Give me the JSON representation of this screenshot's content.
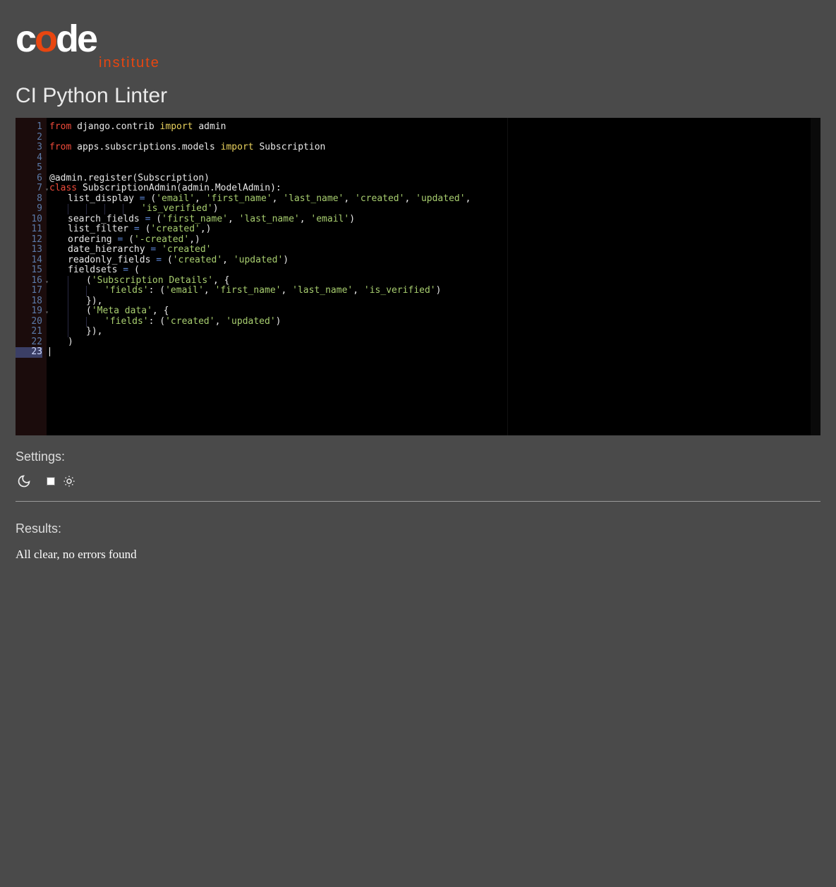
{
  "logo": {
    "top": "code",
    "bottom": "institute"
  },
  "title": "CI Python Linter",
  "code": {
    "lines": [
      {
        "n": 1,
        "fold": false,
        "segments": [
          {
            "t": "from ",
            "c": "kw-red"
          },
          {
            "t": "django.contrib ",
            "c": "fn"
          },
          {
            "t": "import ",
            "c": "kw-yellow"
          },
          {
            "t": "admin",
            "c": "fn"
          }
        ]
      },
      {
        "n": 2,
        "fold": false,
        "segments": []
      },
      {
        "n": 3,
        "fold": false,
        "segments": [
          {
            "t": "from ",
            "c": "kw-red"
          },
          {
            "t": "apps.subscriptions.models ",
            "c": "fn"
          },
          {
            "t": "import ",
            "c": "kw-yellow"
          },
          {
            "t": "Subscription",
            "c": "fn"
          }
        ]
      },
      {
        "n": 4,
        "fold": false,
        "segments": []
      },
      {
        "n": 5,
        "fold": false,
        "segments": []
      },
      {
        "n": 6,
        "fold": false,
        "segments": [
          {
            "t": "@admin.register(Subscription)",
            "c": "fn"
          }
        ]
      },
      {
        "n": 7,
        "fold": true,
        "segments": [
          {
            "t": "class ",
            "c": "kw-red"
          },
          {
            "t": "SubscriptionAdmin",
            "c": "fn"
          },
          {
            "t": "(admin.ModelAdmin):",
            "c": "fn"
          }
        ]
      },
      {
        "n": 8,
        "fold": false,
        "indent": 1,
        "segments": [
          {
            "t": "list_display ",
            "c": "fn"
          },
          {
            "t": "= ",
            "c": "op"
          },
          {
            "t": "(",
            "c": "fn"
          },
          {
            "t": "'email'",
            "c": "str"
          },
          {
            "t": ", ",
            "c": "fn"
          },
          {
            "t": "'first_name'",
            "c": "str"
          },
          {
            "t": ", ",
            "c": "fn"
          },
          {
            "t": "'last_name'",
            "c": "str"
          },
          {
            "t": ", ",
            "c": "fn"
          },
          {
            "t": "'created'",
            "c": "str"
          },
          {
            "t": ", ",
            "c": "fn"
          },
          {
            "t": "'updated'",
            "c": "str"
          },
          {
            "t": ",",
            "c": "fn"
          }
        ]
      },
      {
        "n": 9,
        "fold": false,
        "indent": 5,
        "segments": [
          {
            "t": "'is_verified'",
            "c": "str"
          },
          {
            "t": ")",
            "c": "fn"
          }
        ]
      },
      {
        "n": 10,
        "fold": false,
        "indent": 1,
        "segments": [
          {
            "t": "search_fields ",
            "c": "fn"
          },
          {
            "t": "= ",
            "c": "op"
          },
          {
            "t": "(",
            "c": "fn"
          },
          {
            "t": "'first_name'",
            "c": "str"
          },
          {
            "t": ", ",
            "c": "fn"
          },
          {
            "t": "'last_name'",
            "c": "str"
          },
          {
            "t": ", ",
            "c": "fn"
          },
          {
            "t": "'email'",
            "c": "str"
          },
          {
            "t": ")",
            "c": "fn"
          }
        ]
      },
      {
        "n": 11,
        "fold": false,
        "indent": 1,
        "segments": [
          {
            "t": "list_filter ",
            "c": "fn"
          },
          {
            "t": "= ",
            "c": "op"
          },
          {
            "t": "(",
            "c": "fn"
          },
          {
            "t": "'created'",
            "c": "str"
          },
          {
            "t": ",)",
            "c": "fn"
          }
        ]
      },
      {
        "n": 12,
        "fold": false,
        "indent": 1,
        "segments": [
          {
            "t": "ordering ",
            "c": "fn"
          },
          {
            "t": "= ",
            "c": "op"
          },
          {
            "t": "(",
            "c": "fn"
          },
          {
            "t": "'-created'",
            "c": "str"
          },
          {
            "t": ",)",
            "c": "fn"
          }
        ]
      },
      {
        "n": 13,
        "fold": false,
        "indent": 1,
        "segments": [
          {
            "t": "date_hierarchy ",
            "c": "fn"
          },
          {
            "t": "= ",
            "c": "op"
          },
          {
            "t": "'created'",
            "c": "str"
          }
        ]
      },
      {
        "n": 14,
        "fold": false,
        "indent": 1,
        "segments": [
          {
            "t": "readonly_fields ",
            "c": "fn"
          },
          {
            "t": "= ",
            "c": "op"
          },
          {
            "t": "(",
            "c": "fn"
          },
          {
            "t": "'created'",
            "c": "str"
          },
          {
            "t": ", ",
            "c": "fn"
          },
          {
            "t": "'updated'",
            "c": "str"
          },
          {
            "t": ")",
            "c": "fn"
          }
        ]
      },
      {
        "n": 15,
        "fold": false,
        "indent": 1,
        "segments": [
          {
            "t": "fieldsets ",
            "c": "fn"
          },
          {
            "t": "= ",
            "c": "op"
          },
          {
            "t": "(",
            "c": "fn"
          }
        ]
      },
      {
        "n": 16,
        "fold": true,
        "indent": 2,
        "segments": [
          {
            "t": "(",
            "c": "fn"
          },
          {
            "t": "'Subscription Details'",
            "c": "str"
          },
          {
            "t": ", {",
            "c": "fn"
          }
        ]
      },
      {
        "n": 17,
        "fold": false,
        "indent": 3,
        "segments": [
          {
            "t": "'fields'",
            "c": "str"
          },
          {
            "t": ": (",
            "c": "fn"
          },
          {
            "t": "'email'",
            "c": "str"
          },
          {
            "t": ", ",
            "c": "fn"
          },
          {
            "t": "'first_name'",
            "c": "str"
          },
          {
            "t": ", ",
            "c": "fn"
          },
          {
            "t": "'last_name'",
            "c": "str"
          },
          {
            "t": ", ",
            "c": "fn"
          },
          {
            "t": "'is_verified'",
            "c": "str"
          },
          {
            "t": ")",
            "c": "fn"
          }
        ]
      },
      {
        "n": 18,
        "fold": false,
        "indent": 2,
        "segments": [
          {
            "t": "}),",
            "c": "fn"
          }
        ]
      },
      {
        "n": 19,
        "fold": true,
        "indent": 2,
        "segments": [
          {
            "t": "(",
            "c": "fn"
          },
          {
            "t": "'Meta data'",
            "c": "str"
          },
          {
            "t": ", {",
            "c": "fn"
          }
        ]
      },
      {
        "n": 20,
        "fold": false,
        "indent": 3,
        "segments": [
          {
            "t": "'fields'",
            "c": "str"
          },
          {
            "t": ": (",
            "c": "fn"
          },
          {
            "t": "'created'",
            "c": "str"
          },
          {
            "t": ", ",
            "c": "fn"
          },
          {
            "t": "'updated'",
            "c": "str"
          },
          {
            "t": ")",
            "c": "fn"
          }
        ]
      },
      {
        "n": 21,
        "fold": false,
        "indent": 2,
        "segments": [
          {
            "t": "}),",
            "c": "fn"
          }
        ]
      },
      {
        "n": 22,
        "fold": false,
        "indent": 1,
        "segments": [
          {
            "t": ")",
            "c": "fn"
          }
        ]
      },
      {
        "n": 23,
        "fold": false,
        "active": true,
        "segments": [],
        "cursor": true
      }
    ]
  },
  "settings": {
    "label": "Settings:"
  },
  "results": {
    "label": "Results:",
    "text": "All clear, no errors found"
  }
}
